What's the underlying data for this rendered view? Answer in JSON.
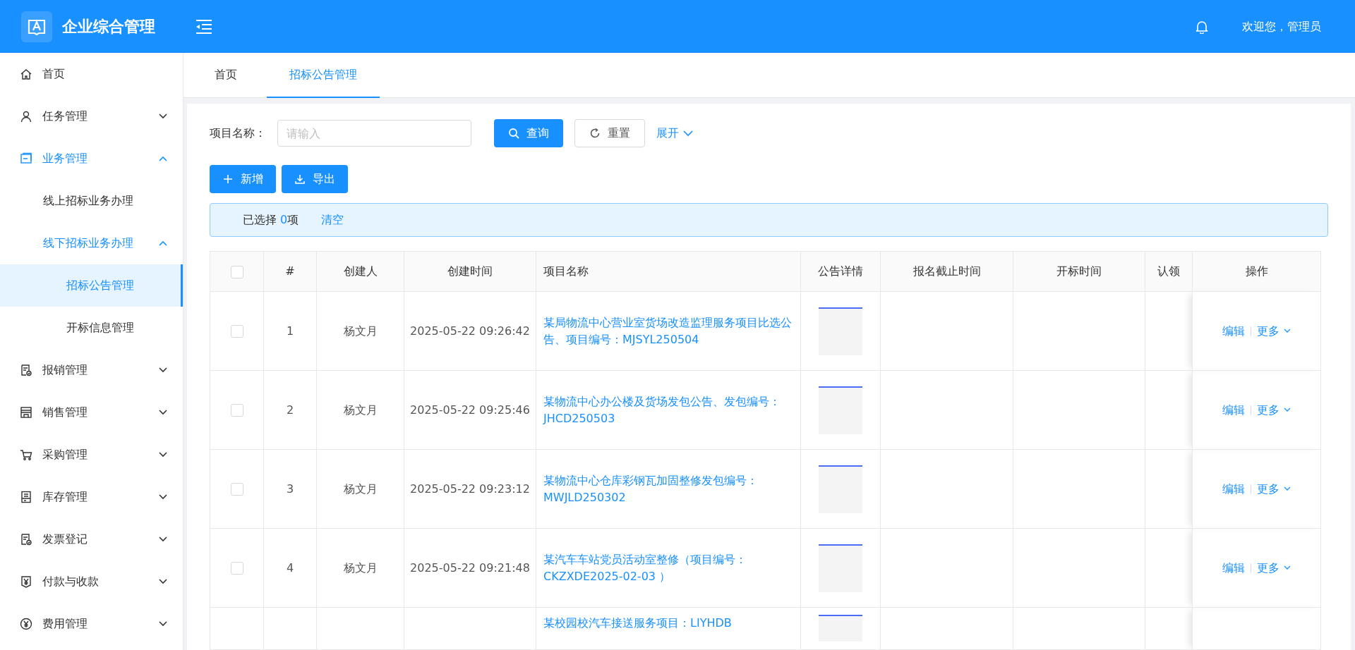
{
  "header": {
    "logo_text": "企业综合管理",
    "greeting": "欢迎您，管理员"
  },
  "sidebar": {
    "items": [
      {
        "label": "首页"
      },
      {
        "label": "任务管理",
        "expanded": false
      },
      {
        "label": "业务管理",
        "expanded": true,
        "children": [
          {
            "label": "线上招标业务办理"
          },
          {
            "label": "线下招标业务办理",
            "expanded": true,
            "children": [
              {
                "label": "招标公告管理",
                "selected": true
              },
              {
                "label": "开标信息管理",
                "selected": false
              }
            ]
          }
        ]
      },
      {
        "label": "报销管理",
        "expanded": false
      },
      {
        "label": "销售管理",
        "expanded": false
      },
      {
        "label": "采购管理",
        "expanded": false
      },
      {
        "label": "库存管理",
        "expanded": false
      },
      {
        "label": "发票登记",
        "expanded": false
      },
      {
        "label": "付款与收款",
        "expanded": false
      },
      {
        "label": "费用管理",
        "expanded": false
      }
    ]
  },
  "tabs": [
    {
      "label": "首页",
      "selected": false
    },
    {
      "label": "招标公告管理",
      "selected": true
    }
  ],
  "search": {
    "label": "项目名称：",
    "placeholder": "请输入",
    "query_button": "查询",
    "reset_button": "重置",
    "expand_link": "展开"
  },
  "actions": [
    "新增",
    "导出"
  ],
  "selection_alert": {
    "prefix": "已选择 ",
    "count": "0",
    "suffix": "项",
    "clear_link": "清空"
  },
  "table": {
    "header_checked": false,
    "columns": [
      "#",
      "创建人",
      "创建时间",
      "项目名称",
      "公告详情",
      "报名截止时间",
      "开标时间",
      "认领",
      "操作"
    ],
    "rows": [
      {
        "checked": false,
        "index": "1",
        "creator": "杨文月",
        "created": "2025-05-22 09:26:42",
        "project": "某局物流中心营业室货场改造监理服务项目比选公告、项目编号：MJSYL250504",
        "actions": [
          "编辑",
          "更多"
        ]
      },
      {
        "checked": false,
        "index": "2",
        "creator": "杨文月",
        "created": "2025-05-22 09:25:46",
        "project": "某物流中心办公楼及货场发包公告、发包编号：JHCD250503",
        "actions": [
          "编辑",
          "更多"
        ]
      },
      {
        "checked": false,
        "index": "3",
        "creator": "杨文月",
        "created": "2025-05-22 09:23:12",
        "project": "某物流中心仓库彩钢瓦加固整修发包编号：MWJLD250302",
        "actions": [
          "编辑",
          "更多"
        ]
      },
      {
        "checked": false,
        "index": "4",
        "creator": "杨文月",
        "created": "2025-05-22 09:21:48",
        "project": "某汽车车站党员活动室整修（项目编号：CKZXDE2025-02-03 ）",
        "actions": [
          "编辑",
          "更多"
        ]
      },
      {
        "project": "某校园校汽车接送服务项目：LIYHDB"
      }
    ]
  }
}
